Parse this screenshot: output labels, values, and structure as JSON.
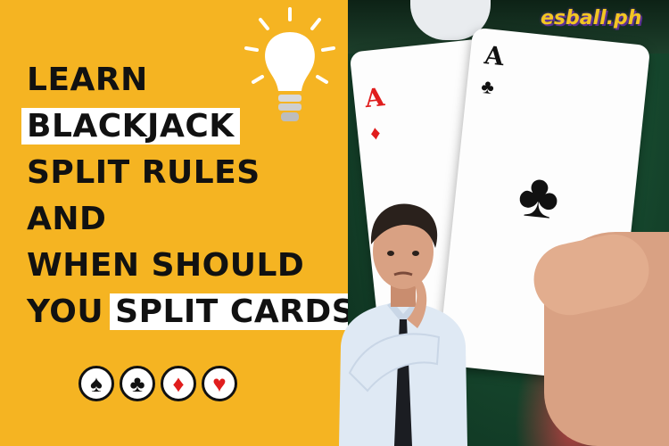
{
  "headline": {
    "line1": "LEARN",
    "line2": "BLACKJACK",
    "line3": "SPLIT RULES",
    "line4": "AND",
    "line5": "WHEN SHOULD",
    "line6_prefix": "YOU ",
    "line6_highlight": "SPLIT CARDS"
  },
  "suits": [
    {
      "name": "spade",
      "glyph": "♠"
    },
    {
      "name": "club",
      "glyph": "♣"
    },
    {
      "name": "diamond",
      "glyph": "♦"
    },
    {
      "name": "heart",
      "glyph": "♥"
    }
  ],
  "cards": {
    "left": {
      "rank": "A",
      "suit": "♦"
    },
    "right": {
      "rank": "A",
      "suit": "♣"
    }
  },
  "logo": "esball.ph",
  "colors": {
    "background": "#f5b422",
    "accent_red": "#e01d1d",
    "text": "#111111"
  }
}
